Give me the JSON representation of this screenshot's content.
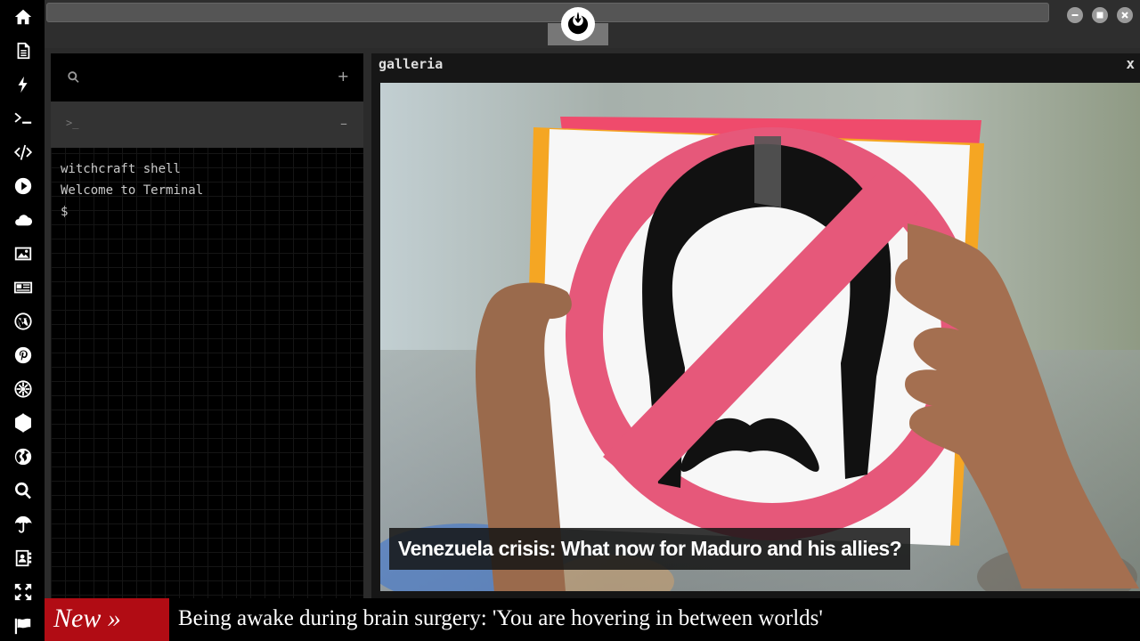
{
  "sidebar": {
    "items": [
      {
        "icon": "home-icon"
      },
      {
        "icon": "document-icon"
      },
      {
        "icon": "lightning-icon"
      },
      {
        "icon": "terminal-icon"
      },
      {
        "icon": "code-icon"
      },
      {
        "icon": "play-icon"
      },
      {
        "icon": "cloud-icon"
      },
      {
        "icon": "image-icon"
      },
      {
        "icon": "newspaper-icon"
      },
      {
        "icon": "wordpress-icon"
      },
      {
        "icon": "pinterest-icon"
      },
      {
        "icon": "settings-wheel-icon"
      },
      {
        "icon": "geometric-sphere-icon"
      },
      {
        "icon": "globe-icon"
      },
      {
        "icon": "search-icon"
      },
      {
        "icon": "umbrella-icon"
      },
      {
        "icon": "contact-card-icon"
      },
      {
        "icon": "expand-icon"
      },
      {
        "icon": "flag-icon"
      }
    ]
  },
  "topbar": {
    "logo": "rebel-alliance-logo",
    "window_buttons": [
      "minimize",
      "maximize",
      "close"
    ]
  },
  "terminal": {
    "search_icon": "search-icon",
    "add_label": "+",
    "tab_prompt": ">_",
    "collapse_label": "–",
    "lines": [
      "witchcraft shell",
      "Welcome to Terminal",
      "$"
    ]
  },
  "gallery": {
    "title": "galleria",
    "close_label": "x",
    "caption": "Venezuela crisis: What now for Maduro and his allies?"
  },
  "ticker": {
    "badge": "New »",
    "headline": "Being awake during brain surgery: 'You are hovering in between worlds'"
  },
  "colors": {
    "ticker_badge": "#b10c14",
    "sign_red": "#e24b6c",
    "sign_orange": "#f5a623"
  }
}
